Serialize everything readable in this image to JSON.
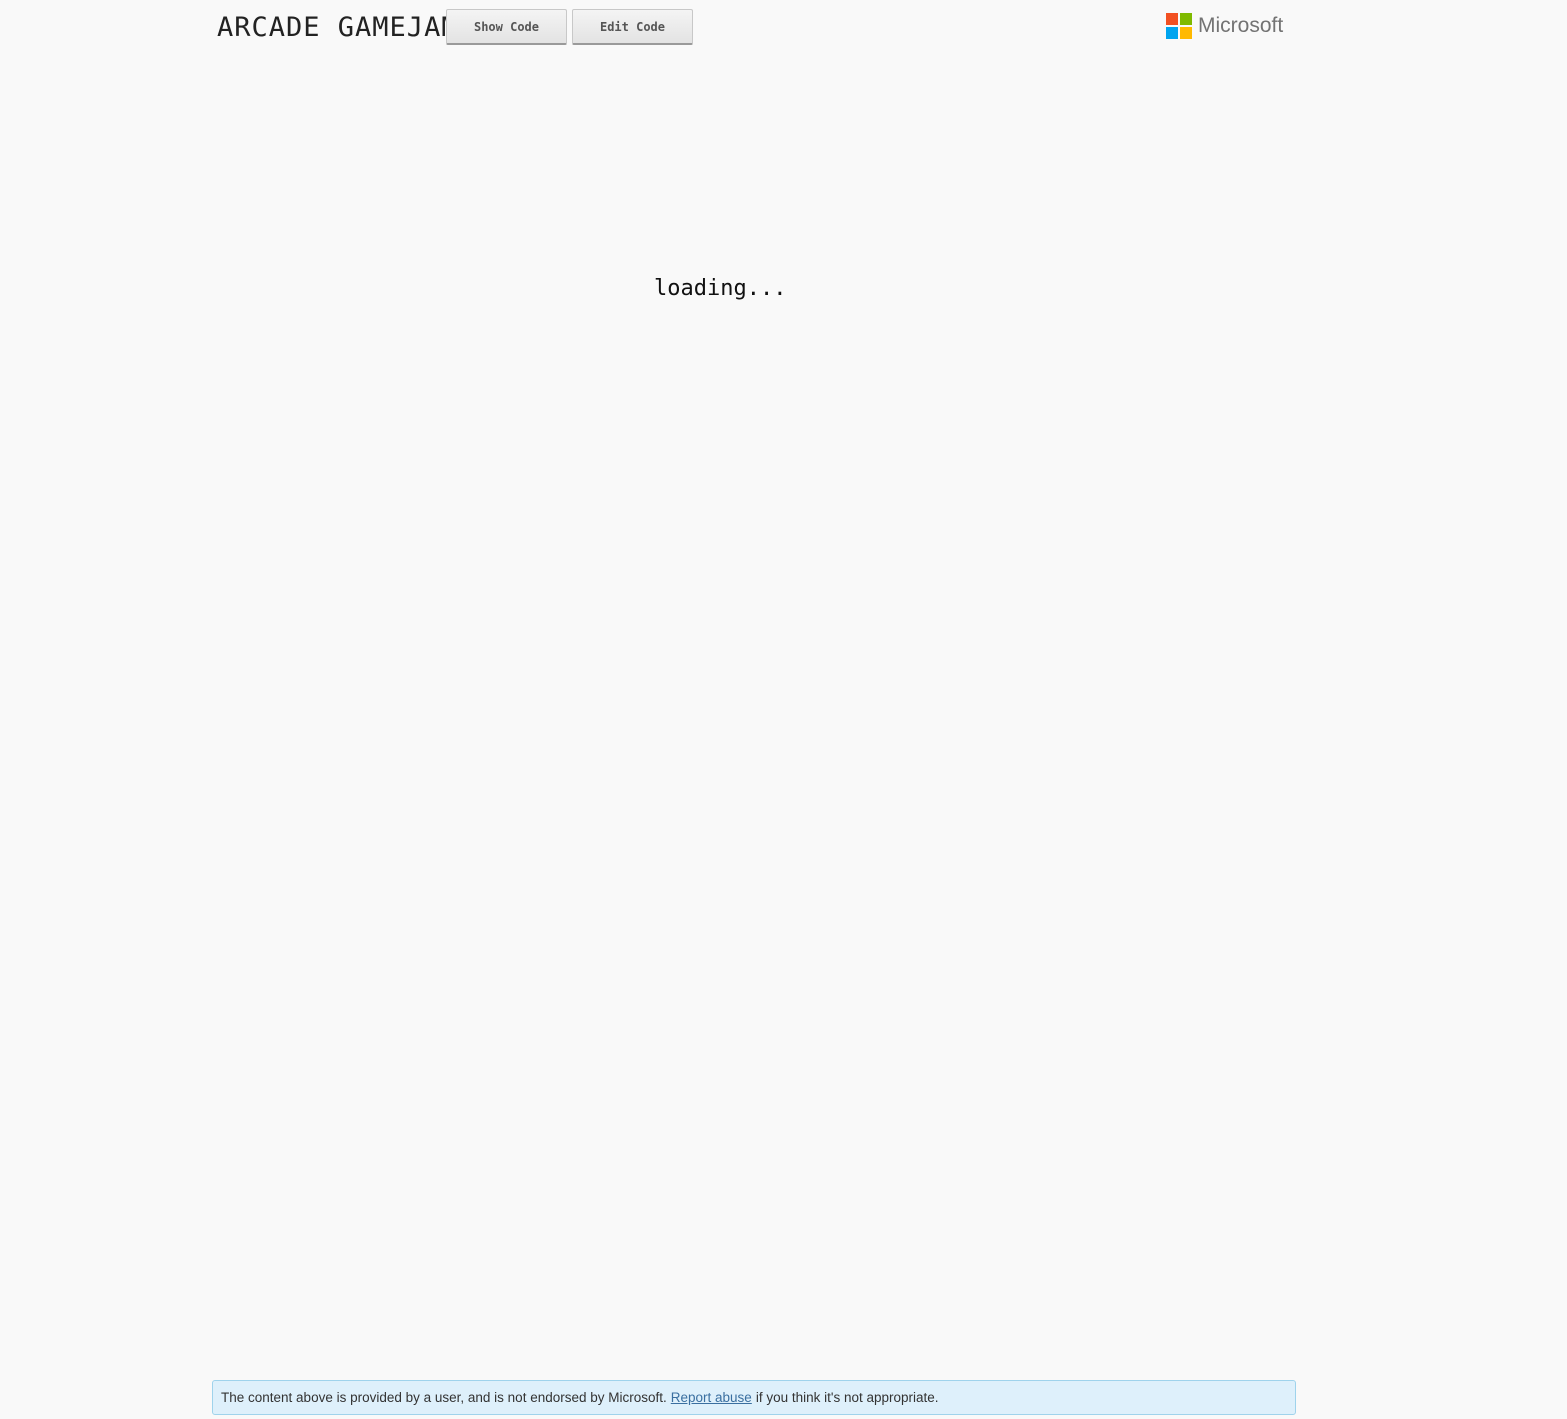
{
  "header": {
    "title": "ARCADE GAMEJAM",
    "show_code_label": "Show Code",
    "edit_code_label": "Edit Code",
    "logo_text": "Microsoft"
  },
  "main": {
    "loading_text": "loading..."
  },
  "footer": {
    "notice_before": "The content above is provided by a user, and is not endorsed by Microsoft.",
    "report_link": "Report abuse",
    "notice_after": "if you think it's not appropriate."
  },
  "colors": {
    "background": "#f9f9f9",
    "notice_bg": "#def0fb",
    "notice_border": "#9fd3ec",
    "link": "#3a6fa0",
    "ms_red": "#f25022",
    "ms_green": "#7fba00",
    "ms_blue": "#00a4ef",
    "ms_yellow": "#ffb900"
  }
}
